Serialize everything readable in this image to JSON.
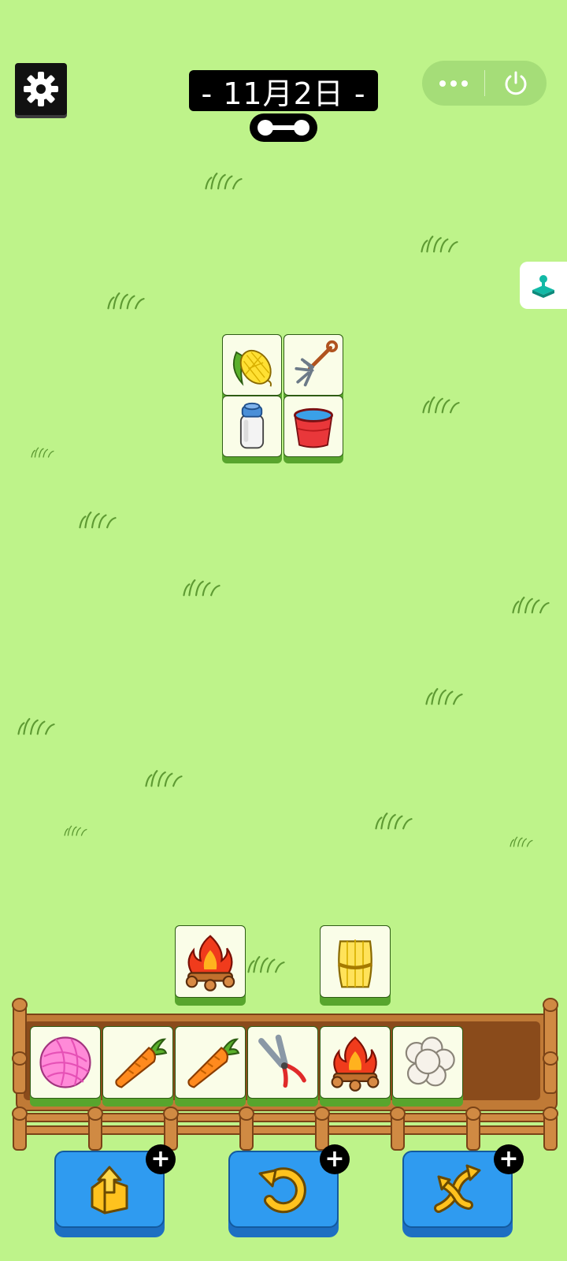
{
  "header": {
    "date_label": "- 11月2日 -",
    "settings_icon": "gear-icon",
    "progress_icon": "bone-progress-icon"
  },
  "capsule": {
    "more_icon": "more-dots-icon",
    "close_icon": "power-icon"
  },
  "side_widget": {
    "icon": "game-hub-icon"
  },
  "board": {
    "tiles": [
      "corn",
      "pitchfork",
      "milk-bottle",
      "red-bucket",
      "campfire",
      "wheat-bundle"
    ]
  },
  "rack": {
    "capacity": 7,
    "items": [
      "yarn-ball",
      "carrot",
      "carrot",
      "pruning-shears",
      "campfire",
      "wool"
    ]
  },
  "tools": [
    {
      "name": "move-out",
      "icon": "move-out-icon",
      "plus": "+"
    },
    {
      "name": "undo",
      "icon": "undo-icon",
      "plus": "+"
    },
    {
      "name": "shuffle",
      "icon": "shuffle-icon",
      "plus": "+"
    }
  ],
  "colors": {
    "background": "#bef38a",
    "tile_face": "#fafde8",
    "tile_base": "#58a52d",
    "tool_button": "#2f9bf0",
    "fence_wood": "#c07a36"
  }
}
